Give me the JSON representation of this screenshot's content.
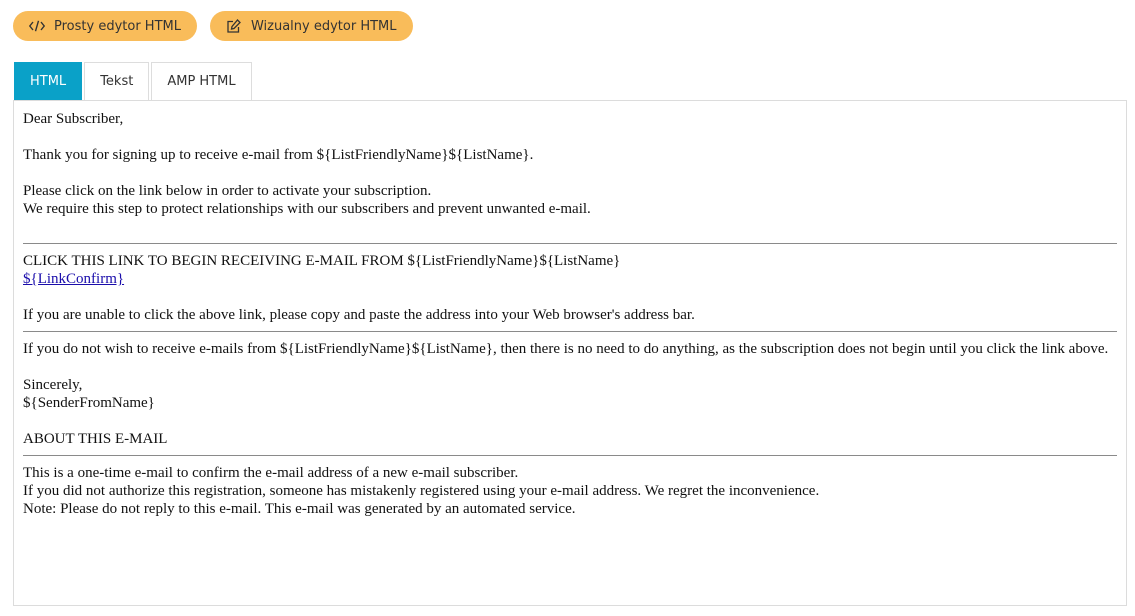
{
  "toolbar": {
    "simple_editor_label": "Prosty edytor HTML",
    "visual_editor_label": "Wizualny edytor HTML"
  },
  "tabs": [
    {
      "label": "HTML",
      "active": true
    },
    {
      "label": "Tekst",
      "active": false
    },
    {
      "label": "AMP HTML",
      "active": false
    }
  ],
  "email": {
    "greeting": "Dear Subscriber,",
    "thanks": "Thank you for signing up to receive e-mail from ${ListFriendlyName}${ListName}.",
    "instruction_line1": "Please click on the link below in order to activate your subscription.",
    "instruction_line2": "We require this step to protect relationships with our subscribers and prevent unwanted e-mail.",
    "click_heading": "CLICK THIS LINK TO BEGIN RECEIVING E-MAIL FROM ${ListFriendlyName}${ListName}",
    "confirm_link": "${LinkConfirm}",
    "copy_paste_note": "If you are unable to click the above link, please copy and paste the address into your Web browser's address bar.",
    "no_action_note": "If you do not wish to receive e-mails from ${ListFriendlyName}${ListName}, then there is no need to do anything, as the subscription does not begin until you click the link above.",
    "sign_off": "Sincerely,",
    "sender": "${SenderFromName}",
    "about_heading": "ABOUT THIS E-MAIL",
    "about_line1": "This is a one-time e-mail to confirm the e-mail address of a new e-mail subscriber.",
    "about_line2": "If you did not authorize this registration, someone has mistakenly registered using your e-mail address. We regret the inconvenience.",
    "about_line3": "Note: Please do not reply to this e-mail. This e-mail was generated by an automated service."
  },
  "colors": {
    "pill_background": "#f9bc5a",
    "active_tab": "#0aa1c8",
    "link": "#1a0dab"
  },
  "icons": {
    "simple_editor": "code-icon",
    "visual_editor": "edit-icon"
  }
}
